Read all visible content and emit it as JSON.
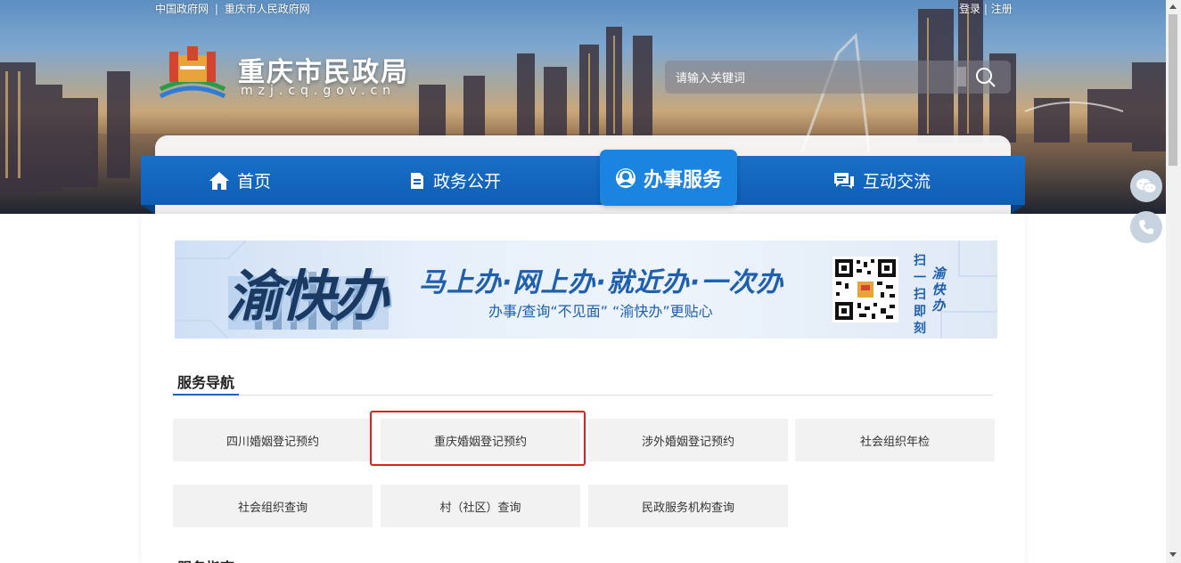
{
  "top_links": {
    "gov_cn": "中国政府网",
    "separator": "|",
    "cq_gov": "重庆市人民政府网",
    "login": "登录",
    "register": "注册"
  },
  "site": {
    "name": "重庆市民政局",
    "domain": "mzj.cq.gov.cn"
  },
  "search": {
    "placeholder": "请输入关键词"
  },
  "nav": {
    "items": [
      {
        "label": "首页",
        "icon": "home-icon"
      },
      {
        "label": "政务公开",
        "icon": "document-icon"
      },
      {
        "label": "办事服务",
        "icon": "service-person-icon",
        "active": true
      },
      {
        "label": "互动交流",
        "icon": "chat-icon"
      }
    ]
  },
  "banner": {
    "brand": "渝快办",
    "slogan": "马上办·网上办·就近办·一次办",
    "subtitle": "办事/查询“不见面” “渝快办”更贴心",
    "side_text_1": "扫一扫即刻",
    "side_text_2": "渝快办"
  },
  "service_nav": {
    "title": "服务导航",
    "items": [
      "四川婚姻登记预约",
      "重庆婚姻登记预约",
      "涉外婚姻登记预约",
      "社会组织年检",
      "社会组织查询",
      "村（社区）查询",
      "民政服务机构查询"
    ],
    "highlighted_index": 1
  },
  "next_section": {
    "title": "服务指南"
  },
  "floating": {
    "buttons": [
      "wechat-icon",
      "phone-icon"
    ]
  },
  "colors": {
    "nav_blue": "#0e5eb5",
    "nav_active": "#1b84e0",
    "highlight_red": "#e02020",
    "tile_bg": "#f2f2f2"
  }
}
